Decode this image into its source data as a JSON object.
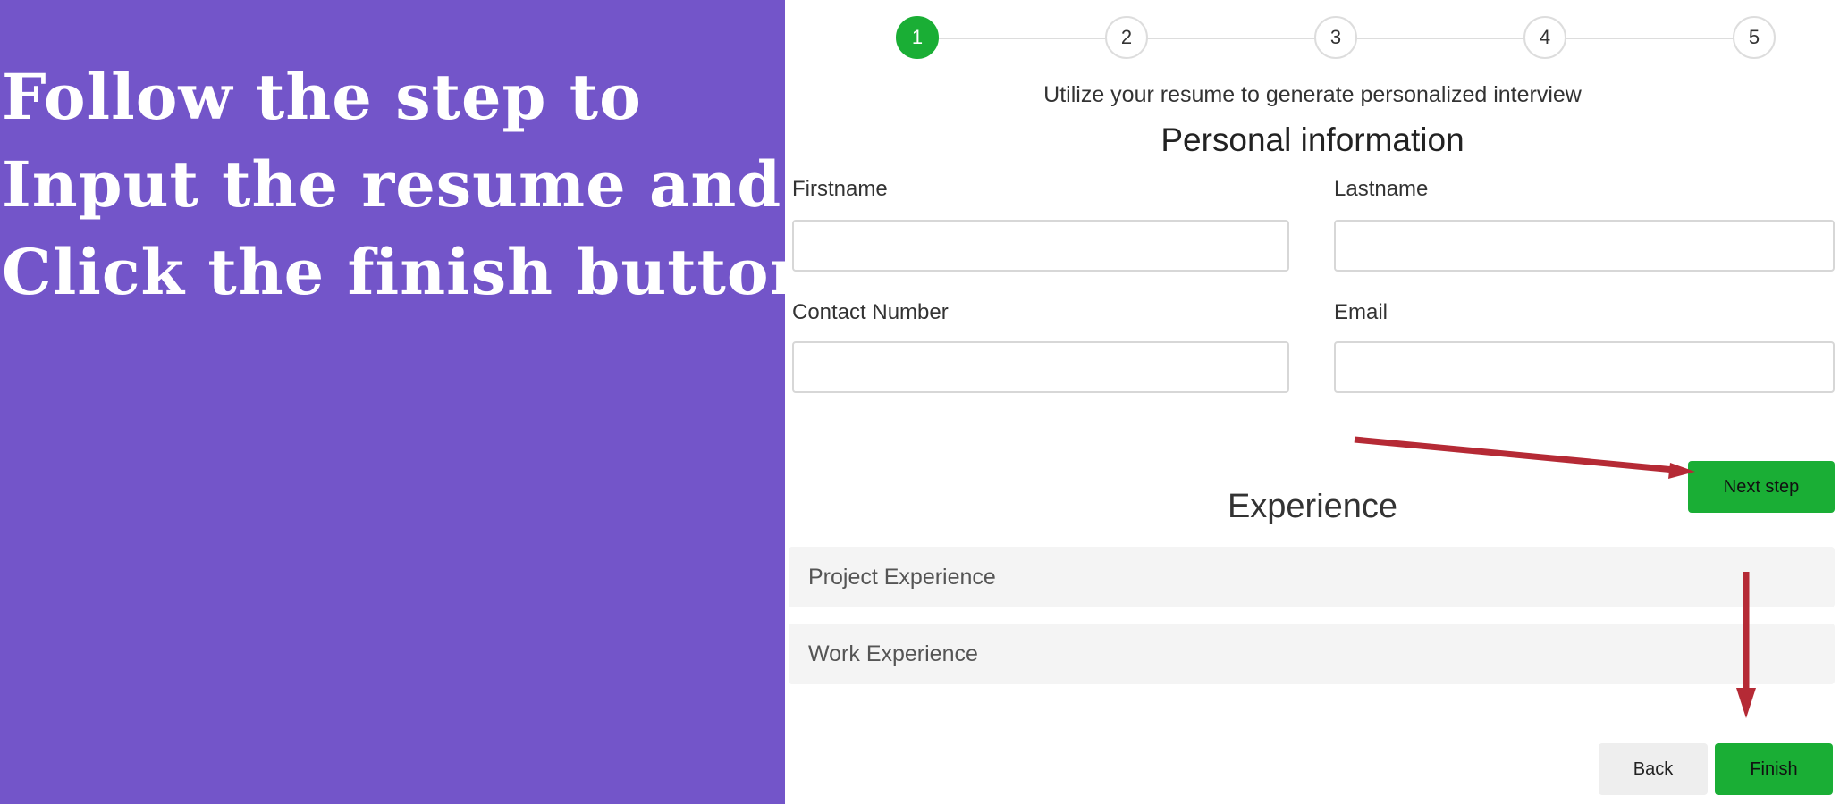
{
  "headline": {
    "lines": [
      "Follow the step to",
      "Input the resume and",
      "Click the finish button"
    ]
  },
  "stepper": {
    "steps": [
      "1",
      "2",
      "3",
      "4",
      "5"
    ],
    "active_step": "1",
    "active_color": "#1aae35"
  },
  "form": {
    "subtitle": "Utilize your resume to generate personalized interview",
    "section_title": "Personal information",
    "firstname": {
      "label": "Firstname",
      "value": "",
      "placeholder": ""
    },
    "lastname": {
      "label": "Lastname",
      "value": "",
      "placeholder": ""
    },
    "contact": {
      "label": "Contact Number",
      "value": "",
      "placeholder": ""
    },
    "email": {
      "label": "Email",
      "value": "",
      "placeholder": ""
    },
    "next_label": "Next step"
  },
  "experience": {
    "title": "Experience",
    "items": [
      "Project Experience",
      "Work Experience"
    ]
  },
  "footer": {
    "back_label": "Back",
    "finish_label": "Finish"
  },
  "colors": {
    "left_panel": "#7355c9",
    "accent_green": "#1aae35",
    "annotation_arrow": "#b52a35"
  }
}
